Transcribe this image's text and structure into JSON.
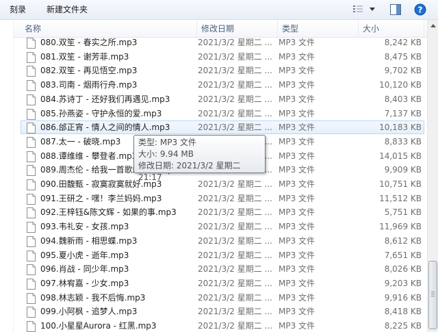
{
  "toolbar": {
    "burn_label": "刻录",
    "new_folder_label": "新建文件夹",
    "icons": [
      "view-options-icon",
      "dropdown-arrow-icon",
      "preview-pane-icon",
      "help-icon"
    ]
  },
  "columns": {
    "name": "名称",
    "date": "修改日期",
    "type": "类型",
    "size": "大小"
  },
  "files": [
    {
      "name": "080.双笙 - 春实之所.mp3",
      "date": "2021/3/2 星期二 ...",
      "type": "MP3 文件",
      "size": "8,242 KB"
    },
    {
      "name": "081.双笙 - 谢芳菲.mp3",
      "date": "2021/3/2 星期二 ...",
      "type": "MP3 文件",
      "size": "8,475 KB"
    },
    {
      "name": "082.双笙 - 再见悟空.mp3",
      "date": "2021/3/2 星期二 ...",
      "type": "MP3 文件",
      "size": "9,702 KB"
    },
    {
      "name": "083.司南 - 烟雨行舟.mp3",
      "date": "2021/3/2 星期二 ...",
      "type": "MP3 文件",
      "size": "10,120 KB"
    },
    {
      "name": "084.苏诗丁 - 还好我们再遇见.mp3",
      "date": "2021/3/2 星期二 ...",
      "type": "MP3 文件",
      "size": "8,403 KB"
    },
    {
      "name": "085.孙燕姿 - 守护永恒的爱.mp3",
      "date": "2021/3/2 星期二 ...",
      "type": "MP3 文件",
      "size": "7,137 KB"
    },
    {
      "name": "086.邰正宵 - 情人之间的情人.mp3",
      "date": "2021/3/2 星期二 ...",
      "type": "MP3 文件",
      "size": "10,183 KB"
    },
    {
      "name": "087.太一 - 破晓.mp3",
      "date": "2021/3/2 星期二 ...",
      "type": "MP3 文件",
      "size": "8,833 KB"
    },
    {
      "name": "088.谭维维 - 攀登者.mp3",
      "date": "2021/3/2 星期二 ...",
      "type": "MP3 文件",
      "size": "14,015 KB"
    },
    {
      "name": "089.周杰伦 - 给我一首歌的时间.mp3",
      "date": "2021/3/2 星期二 ...",
      "type": "MP3 文件",
      "size": "9,909 KB"
    },
    {
      "name": "090.田馥甄 - 寂寞寂寞就好.mp3",
      "date": "2021/3/2 星期二 ...",
      "type": "MP3 文件",
      "size": "10,751 KB"
    },
    {
      "name": "091.王研之 - 嘿！李兰妈妈.mp3",
      "date": "2021/3/2 星期二 ...",
      "type": "MP3 文件",
      "size": "11,512 KB"
    },
    {
      "name": "092.王梓钰&陈文辉 - 如果的事.mp3",
      "date": "2021/3/2 星期二 ...",
      "type": "MP3 文件",
      "size": "5,751 KB"
    },
    {
      "name": "093.韦礼安 - 女孩.mp3",
      "date": "2021/3/2 星期二 ...",
      "type": "MP3 文件",
      "size": "11,969 KB"
    },
    {
      "name": "094.魏新雨 - 相思蝶.mp3",
      "date": "2021/3/2 星期二 ...",
      "type": "MP3 文件",
      "size": "8,612 KB"
    },
    {
      "name": "095.夏小虎 - 逝年.mp3",
      "date": "2021/3/2 星期二 ...",
      "type": "MP3 文件",
      "size": "7,651 KB"
    },
    {
      "name": "096.肖战 - 同少年.mp3",
      "date": "2021/3/2 星期二 ...",
      "type": "MP3 文件",
      "size": "8,026 KB"
    },
    {
      "name": "097.林宥嘉 - 少女.mp3",
      "date": "2021/3/2 星期二 ...",
      "type": "MP3 文件",
      "size": "9,203 KB"
    },
    {
      "name": "098.林志颖 - 我不后悔.mp3",
      "date": "2021/3/2 星期二 ...",
      "type": "MP3 文件",
      "size": "9,916 KB"
    },
    {
      "name": "099.小阿枫 - 追梦人.mp3",
      "date": "2021/3/2 星期二 ...",
      "type": "MP3 文件",
      "size": "8,418 KB"
    },
    {
      "name": "100.小星星Aurora - 红黑.mp3",
      "date": "2021/3/2 星期二 ...",
      "type": "MP3 文件",
      "size": "8,225 KB"
    }
  ],
  "hover_index": 6,
  "tooltip": {
    "type_line": "类型: MP3 文件",
    "size_line": "大小: 9.94 MB",
    "date_line": "修改日期: 2021/3/2 星期二 21:17"
  },
  "colors": {
    "hover_fill": "#e5f0fc",
    "hover_border": "#b8d6fb",
    "header_text": "#4c607a",
    "help_icon": "#1f6fd1"
  }
}
